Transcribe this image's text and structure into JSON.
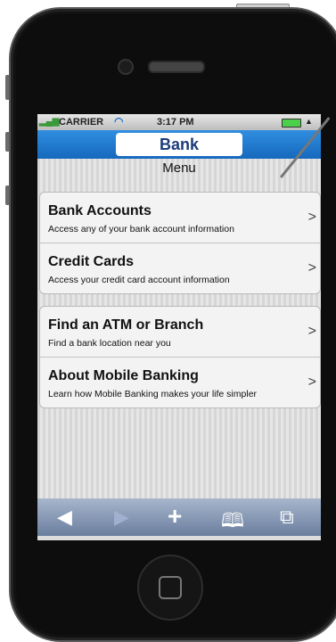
{
  "status_bar": {
    "carrier": "CARRIER",
    "time": "3:17 PM"
  },
  "nav_bar": {
    "title": "Bank"
  },
  "menu": {
    "label": "Menu",
    "group1": [
      {
        "title": "Bank Accounts",
        "subtitle": "Access any of your bank account information",
        "chevron": ">"
      },
      {
        "title": "Credit Cards",
        "subtitle": "Access your credit card account information",
        "chevron": ">"
      }
    ],
    "group2": [
      {
        "title": "Find an ATM or Branch",
        "subtitle": "Find a bank location near you",
        "chevron": ">"
      },
      {
        "title": "About Mobile Banking",
        "subtitle": "Learn how Mobile Banking makes your life simpler",
        "chevron": ">"
      }
    ]
  },
  "toolbar": {
    "back": "◀",
    "forward": "▶",
    "add": "+",
    "bookmarks": "🕮",
    "tabs": "⧉"
  },
  "icons": {
    "signal": "signal-bars-icon",
    "wifi": "wifi-icon",
    "battery": "battery-icon",
    "location": "location-arrow-icon"
  },
  "colors": {
    "nav_bar": "#1c74cf",
    "title_text": "#1b3c78",
    "toolbar": "#8194b3",
    "battery": "#4cd04c"
  }
}
